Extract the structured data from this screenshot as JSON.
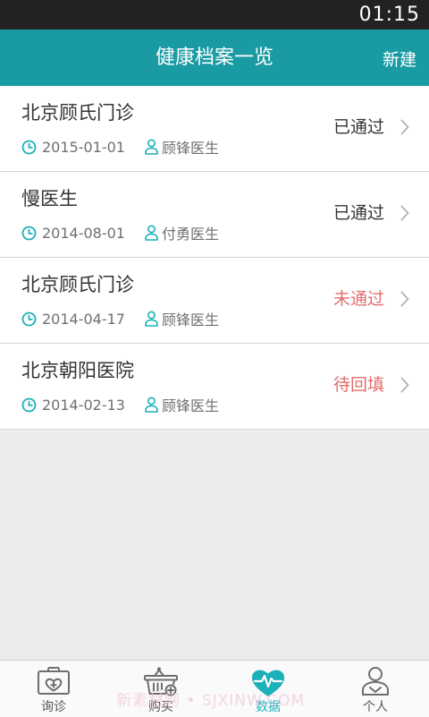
{
  "status_bar": {
    "time": "01:15"
  },
  "header": {
    "title": "健康档案一览",
    "action_label": "新建"
  },
  "records": [
    {
      "name": "北京顾氏门诊",
      "date": "2015-01-01",
      "doctor": "顾锋医生",
      "status": "已通过",
      "status_type": "approved"
    },
    {
      "name": "慢医生",
      "date": "2014-08-01",
      "doctor": "付勇医生",
      "status": "已通过",
      "status_type": "approved"
    },
    {
      "name": "北京顾氏门诊",
      "date": "2014-04-17",
      "doctor": "顾锋医生",
      "status": "未通过",
      "status_type": "rejected"
    },
    {
      "name": "北京朝阳医院",
      "date": "2014-02-13",
      "doctor": "顾锋医生",
      "status": "待回填",
      "status_type": "pending"
    }
  ],
  "tabs": [
    {
      "label": "询诊",
      "icon": "medical-kit-icon",
      "active": false
    },
    {
      "label": "购买",
      "icon": "shopping-basket-icon",
      "active": false
    },
    {
      "label": "数据",
      "icon": "heart-pulse-icon",
      "active": true
    },
    {
      "label": "个人",
      "icon": "person-icon",
      "active": false
    }
  ],
  "watermark": "新素材网 • SJXINW.COM",
  "colors": {
    "accent": "#1a9aa3",
    "active_tab": "#1cb0b9",
    "status_approved": "#333333",
    "status_attention": "#e26d6d"
  }
}
